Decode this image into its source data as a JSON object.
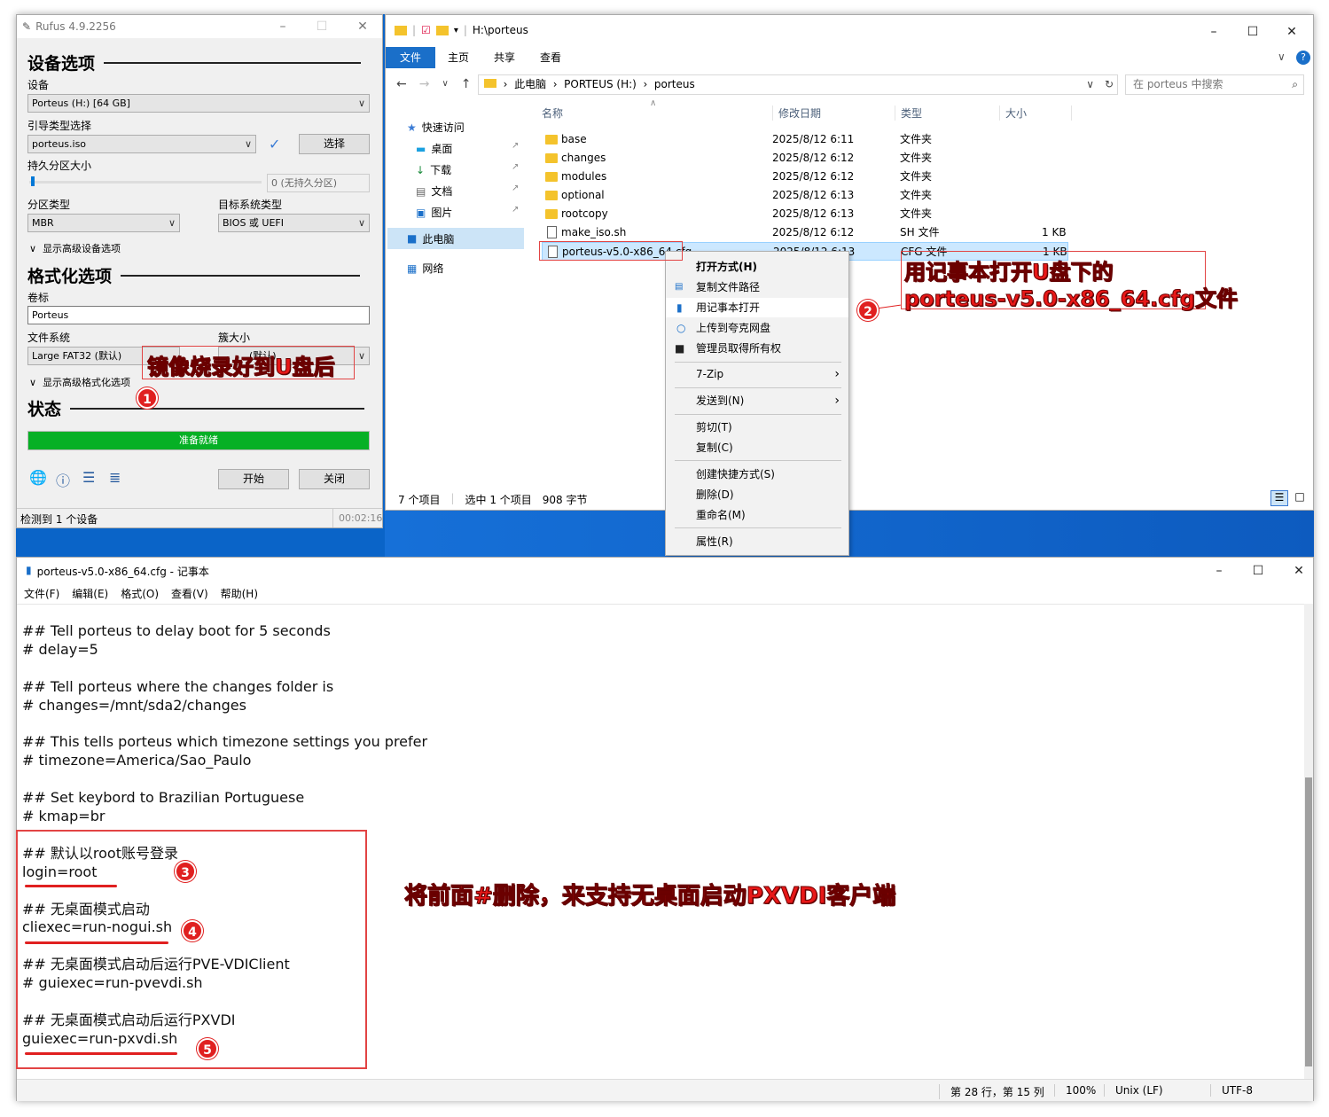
{
  "rufus": {
    "title": "Rufus 4.9.2256",
    "section_device": "设备选项",
    "label_device": "设备",
    "device_value": "Porteus (H:) [64 GB]",
    "label_boot": "引导类型选择",
    "boot_value": "porteus.iso",
    "select_button": "选择",
    "label_persistent": "持久分区大小",
    "persistent_value": "0 (无持久分区)",
    "label_partition": "分区类型",
    "partition_value": "MBR",
    "label_target": "目标系统类型",
    "target_value": "BIOS 或 UEFI",
    "advanced_device": "显示高级设备选项",
    "section_format": "格式化选项",
    "label_volume": "卷标",
    "volume_value": "Porteus",
    "label_fs": "文件系统",
    "fs_value": "Large FAT32 (默认)",
    "label_cluster": "簇大小",
    "cluster_value": "(默认)",
    "advanced_format": "显示高级格式化选项",
    "section_status": "状态",
    "status_bar": "准备就绪",
    "progress": 1.0,
    "start_button": "开始",
    "close_button": "关闭",
    "footer_left": "检测到 1 个设备",
    "footer_time": "00:02:16"
  },
  "explorer": {
    "title_path": "H:\\porteus",
    "tabs": [
      "文件",
      "主页",
      "共享",
      "查看"
    ],
    "breadcrumb": [
      "此电脑",
      "PORTEUS (H:)",
      "porteus"
    ],
    "search_placeholder": "在 porteus 中搜索",
    "nav": [
      "快速访问",
      "桌面",
      "下载",
      "文档",
      "图片",
      "此电脑",
      "网络"
    ],
    "columns": [
      "名称",
      "修改日期",
      "类型",
      "大小"
    ],
    "files": [
      {
        "name": "base",
        "date": "2025/8/12 6:11",
        "type": "文件夹",
        "size": ""
      },
      {
        "name": "changes",
        "date": "2025/8/12 6:12",
        "type": "文件夹",
        "size": ""
      },
      {
        "name": "modules",
        "date": "2025/8/12 6:12",
        "type": "文件夹",
        "size": ""
      },
      {
        "name": "optional",
        "date": "2025/8/12 6:13",
        "type": "文件夹",
        "size": ""
      },
      {
        "name": "rootcopy",
        "date": "2025/8/12 6:13",
        "type": "文件夹",
        "size": ""
      },
      {
        "name": "make_iso.sh",
        "date": "2025/8/12 6:12",
        "type": "SH 文件",
        "size": "1 KB"
      },
      {
        "name": "porteus-v5.0-x86_64.cfg",
        "date": "2025/8/12 6:13",
        "type": "CFG 文件",
        "size": "1 KB"
      }
    ],
    "status_count": "7 个项目",
    "status_selected": "选中 1 个项目",
    "status_size": "908 字节"
  },
  "context_menu": {
    "items": [
      "打开方式(H)",
      "复制文件路径",
      "用记事本打开",
      "上传到夸克网盘",
      "管理员取得所有权",
      "7-Zip",
      "发送到(N)",
      "剪切(T)",
      "复制(C)",
      "创建快捷方式(S)",
      "删除(D)",
      "重命名(M)",
      "属性(R)"
    ]
  },
  "notepad": {
    "title": "porteus-v5.0-x86_64.cfg - 记事本",
    "menu": [
      "文件(F)",
      "编辑(E)",
      "格式(O)",
      "查看(V)",
      "帮助(H)"
    ],
    "lines": [
      "## Tell porteus to delay boot for 5 seconds",
      "# delay=5",
      "",
      "## Tell porteus where the changes folder is",
      "# changes=/mnt/sda2/changes",
      "",
      "## This tells porteus which timezone settings you prefer",
      "# timezone=America/Sao_Paulo",
      "",
      "## Set keybord to Brazilian Portuguese",
      "# kmap=br",
      "",
      "## 默认以root账号登录",
      "login=root",
      "",
      "## 无桌面模式启动",
      "cliexec=run-nogui.sh",
      "",
      "## 无桌面模式启动后运行PVE-VDIClient",
      "# guiexec=run-pvevdi.sh",
      "",
      "## 无桌面模式启动后运行PXVDI",
      "guiexec=run-pxvdi.sh"
    ],
    "status_pos": "第 28 行，第 15 列",
    "status_zoom": "100%",
    "status_eol": "Unix (LF)",
    "status_enc": "UTF-8"
  },
  "annotations": {
    "a1": "镜像烧录好到U盘后",
    "a2_line1": "用记事本打开U盘下的",
    "a2_line2": "porteus-v5.0-x86_64.cfg文件",
    "a3": "将前面#删除，来支持无桌面启动PXVDI客户端",
    "badges": [
      "1",
      "2",
      "3",
      "4",
      "5"
    ]
  },
  "colors": {
    "accent": "#0a64c8",
    "progress": "#06b025",
    "annotation": "#e81818"
  }
}
